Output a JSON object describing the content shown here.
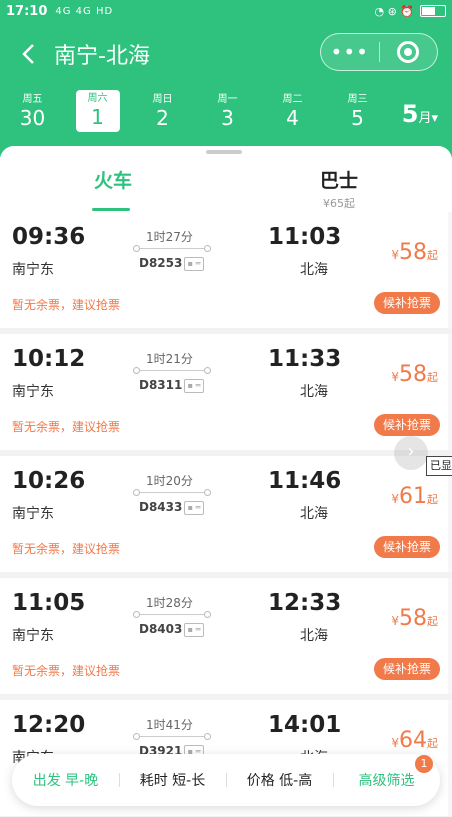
{
  "status_bar": {
    "time": "17:10",
    "signal": "4G 4G HD",
    "icons": "◔ ⊛ ⏰"
  },
  "header": {
    "title": "南宁-北海",
    "more_label": "•••"
  },
  "dates": [
    {
      "weekday": "周五",
      "day": "30",
      "active": false
    },
    {
      "weekday": "周六",
      "day": "1",
      "active": true
    },
    {
      "weekday": "周日",
      "day": "2",
      "active": false
    },
    {
      "weekday": "周一",
      "day": "3",
      "active": false
    },
    {
      "weekday": "周二",
      "day": "4",
      "active": false
    },
    {
      "weekday": "周三",
      "day": "5",
      "active": false
    }
  ],
  "month": {
    "number": "5",
    "unit": "月▾"
  },
  "tabs": [
    {
      "label": "火车",
      "sub": ""
    },
    {
      "label": "巴士",
      "sub": "¥65起"
    }
  ],
  "trains": [
    {
      "dep_time": "09:36",
      "dep_station": "南宁东",
      "duration": "1时27分",
      "number": "D8253",
      "arr_time": "11:03",
      "arr_station": "北海",
      "currency": "¥",
      "price": "58",
      "price_unit": "起",
      "note": "暂无余票，建议抢票",
      "button": "候补抢票"
    },
    {
      "dep_time": "10:12",
      "dep_station": "南宁东",
      "duration": "1时21分",
      "number": "D8311",
      "arr_time": "11:33",
      "arr_station": "北海",
      "currency": "¥",
      "price": "58",
      "price_unit": "起",
      "note": "暂无余票，建议抢票",
      "button": "候补抢票"
    },
    {
      "dep_time": "10:26",
      "dep_station": "南宁东",
      "duration": "1时20分",
      "number": "D8433",
      "arr_time": "11:46",
      "arr_station": "北海",
      "currency": "¥",
      "price": "61",
      "price_unit": "起",
      "note": "暂无余票，建议抢票",
      "button": "候补抢票"
    },
    {
      "dep_time": "11:05",
      "dep_station": "南宁东",
      "duration": "1时28分",
      "number": "D8403",
      "arr_time": "12:33",
      "arr_station": "北海",
      "currency": "¥",
      "price": "58",
      "price_unit": "起",
      "note": "暂无余票，建议抢票",
      "button": "候补抢票"
    },
    {
      "dep_time": "12:20",
      "dep_station": "南宁东",
      "duration": "1时41分",
      "number": "D3921",
      "arr_time": "14:01",
      "arr_station": "北海",
      "currency": "¥",
      "price": "64",
      "price_unit": "起",
      "note": "",
      "button": ""
    }
  ],
  "id_icon": "▪ ═",
  "tooltip": "已显",
  "filters": [
    {
      "label": "出发 早-晚",
      "active": true
    },
    {
      "label": "耗时 短-长",
      "active": false
    },
    {
      "label": "价格 低-高",
      "active": false
    },
    {
      "label": "高级筛选",
      "active": true
    }
  ],
  "filter_badge": "1",
  "colors": {
    "brand": "#2ec27e",
    "accent": "#f07a4a"
  }
}
